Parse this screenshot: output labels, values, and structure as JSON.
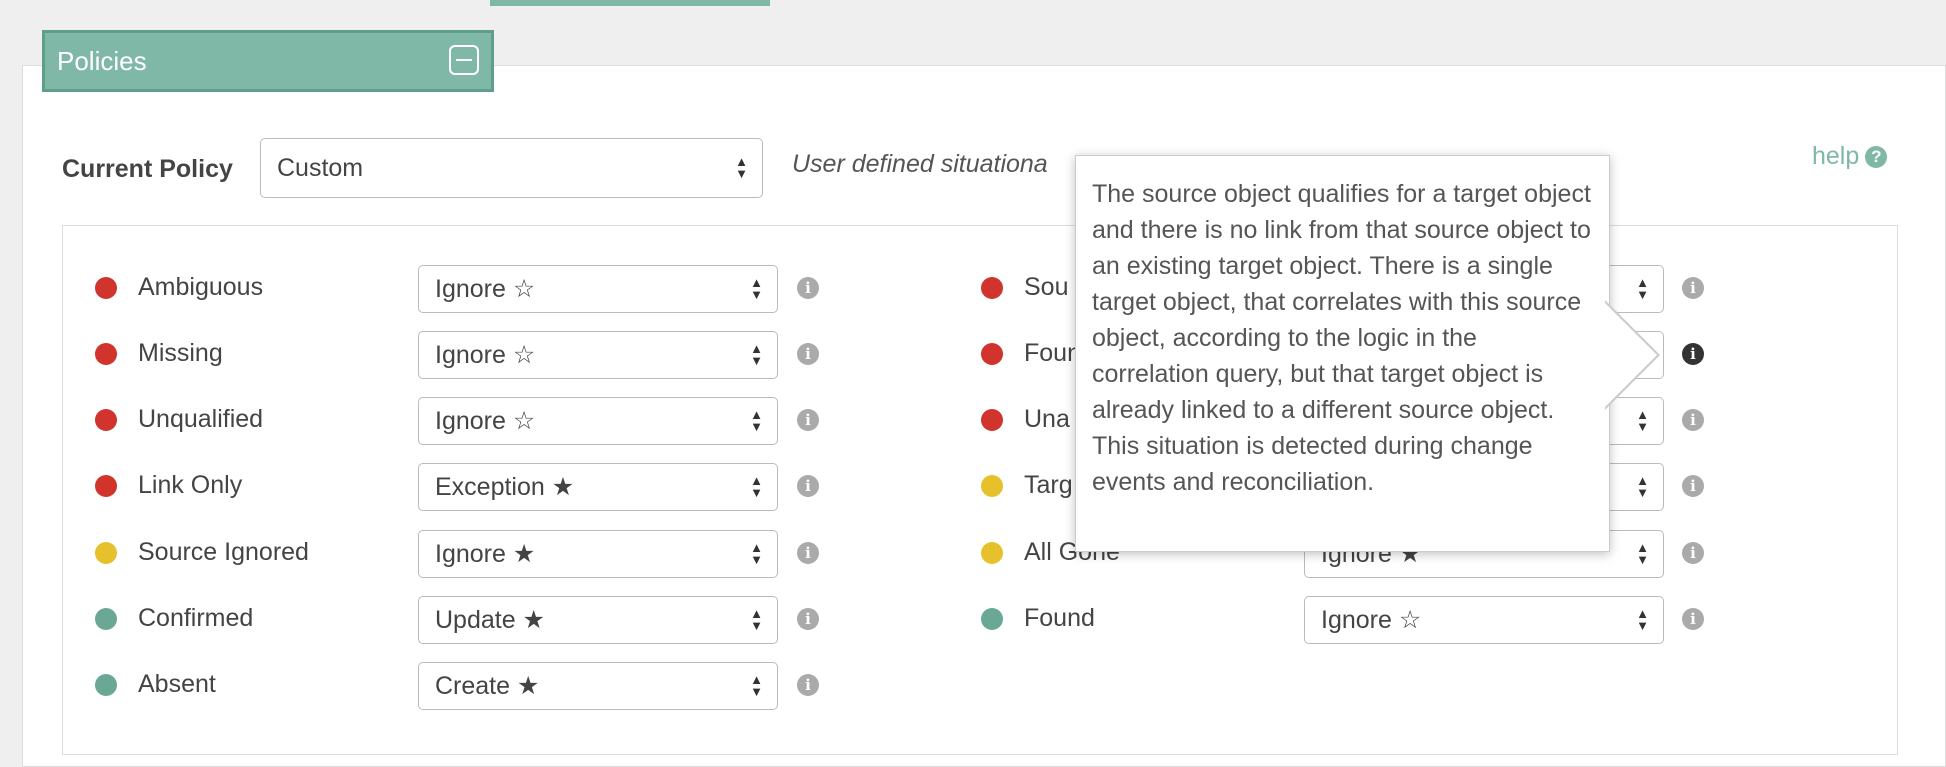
{
  "panel": {
    "title": "Policies"
  },
  "current_policy": {
    "label": "Current Policy",
    "selected": "Custom",
    "description": "User defined situationa",
    "help_label": "help"
  },
  "colors": {
    "red": "#d0342c",
    "yellow": "#e6c12b",
    "green": "#6aa895",
    "accent": "#7fb8a6"
  },
  "situations_left": [
    {
      "name": "Ambiguous",
      "status": "red",
      "action": "Ignore ☆"
    },
    {
      "name": "Missing",
      "status": "red",
      "action": "Ignore ☆"
    },
    {
      "name": "Unqualified",
      "status": "red",
      "action": "Ignore ☆"
    },
    {
      "name": "Link Only",
      "status": "red",
      "action": "Exception ★"
    },
    {
      "name": "Source Ignored",
      "status": "yellow",
      "action": "Ignore ★"
    },
    {
      "name": "Confirmed",
      "status": "green",
      "action": "Update ★"
    },
    {
      "name": "Absent",
      "status": "green",
      "action": "Create ★"
    }
  ],
  "situations_right": [
    {
      "name": "Sou",
      "status": "red",
      "action": ""
    },
    {
      "name": "Foun",
      "status": "red",
      "action": ""
    },
    {
      "name": "Una",
      "status": "red",
      "action": ""
    },
    {
      "name": "Targ",
      "status": "yellow",
      "action": ""
    },
    {
      "name": "All Gone",
      "status": "yellow",
      "action": "Ignore ★"
    },
    {
      "name": "Found",
      "status": "green",
      "action": "Ignore ☆"
    }
  ],
  "tooltip": {
    "text": "The source object qualifies for a target object and there is no link from that source object to an existing target object. There is a single target object, that correlates with this source object, according to the logic in the correlation query, but that target object is already linked to a different source object. This situation is detected during change events and reconciliation."
  }
}
